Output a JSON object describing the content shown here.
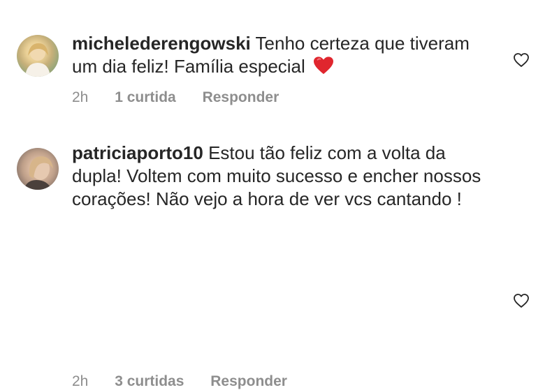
{
  "comments": [
    {
      "username": "michelederengowski",
      "text": "Tenho certeza que tiveram um dia feliz! Família especial",
      "emoji": "heart-emoji",
      "time": "2h",
      "likes": "1 curtida",
      "reply": "Responder"
    },
    {
      "username": "patriciaporto10",
      "text": "Estou tão feliz com a volta da dupla! Voltem com muito sucesso e encher nossos corações! Não vejo a hora de ver vcs cantando !",
      "time": "2h",
      "likes": "3 curtidas",
      "reply": "Responder"
    }
  ],
  "icons": {
    "like": "heart-outline-icon"
  },
  "colors": {
    "text": "#262626",
    "secondary": "#8e8e8e",
    "heart_emoji": "#e0262e"
  }
}
